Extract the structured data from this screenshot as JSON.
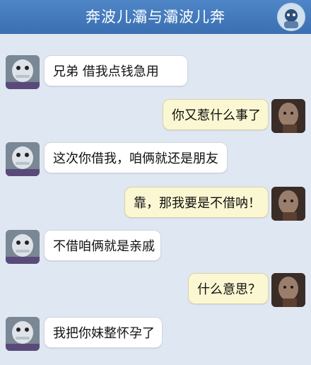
{
  "header": {
    "title": "奔波儿灞与灞波儿奔"
  },
  "messages": [
    {
      "side": "left",
      "text": "兄弟  借我点钱急用"
    },
    {
      "side": "right",
      "text": "你又惹什么事了"
    },
    {
      "side": "left",
      "text": "这次你借我，咱俩就还是朋友"
    },
    {
      "side": "right",
      "text": "靠，那我要是不借呐！"
    },
    {
      "side": "left",
      "text": "不借咱俩就是亲戚"
    },
    {
      "side": "right",
      "text": "什么意思？"
    },
    {
      "side": "left",
      "text": "我把你妹整怀孕了"
    }
  ],
  "colors": {
    "titlebar": "#3f78bd",
    "background": "#dfe7f2",
    "left_bubble": "#ffffff",
    "right_bubble": "#fbf7d2"
  }
}
